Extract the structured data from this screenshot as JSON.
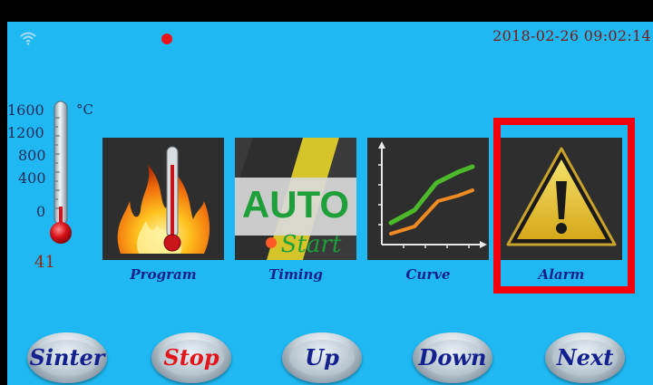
{
  "status_bar": {
    "datetime": "2018-02-26 09:02:14",
    "wifi_icon": "wifi-icon",
    "indicator_color": "#e8141a"
  },
  "thermometer": {
    "scale": [
      "1600",
      "1200",
      "800",
      "400",
      "0"
    ],
    "unit": "°C",
    "current": "41",
    "level": 0.03
  },
  "tiles": [
    {
      "label": "Program",
      "icon": "fire-thermometer-icon"
    },
    {
      "label": "Timing",
      "icon": "auto-start-icon",
      "art_top": "AUTO",
      "art_bottom": "Start"
    },
    {
      "label": "Curve",
      "icon": "curve-chart-icon"
    },
    {
      "label": "Alarm",
      "icon": "warning-icon"
    }
  ],
  "buttons": [
    {
      "label": "Sinter",
      "color": "#15208f"
    },
    {
      "label": "Stop",
      "color": "#e3141c"
    },
    {
      "label": "Up",
      "color": "#15208f"
    },
    {
      "label": "Down",
      "color": "#15208f"
    },
    {
      "label": "Next",
      "color": "#15208f"
    }
  ],
  "colors": {
    "background": "#1fb8f2",
    "alarm_highlight": "#f2000c",
    "label": "#15208f"
  }
}
